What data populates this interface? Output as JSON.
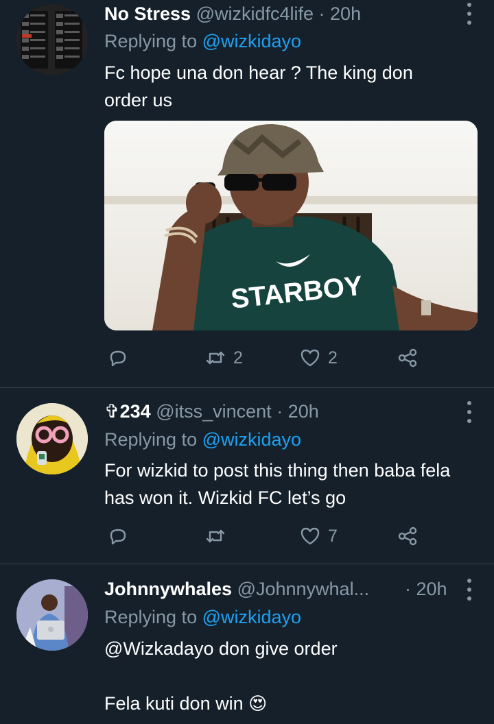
{
  "tweets": [
    {
      "name": "No Stress",
      "handle": "@wizkidfc4life",
      "time": "· 20h",
      "reply_prefix": "Replying to",
      "reply_mention": "@wizkidayo",
      "text": "Fc hope una don hear ? The king don order us",
      "retweets": "2",
      "likes": "2",
      "media_text": "STARBOY"
    },
    {
      "name": "✞234",
      "handle": "@itss_vincent",
      "time": "· 20h",
      "reply_prefix": "Replying to",
      "reply_mention": "@wizkidayo",
      "text": "For wizkid to post this thing then baba fela has won it. Wizkid FC let’s go",
      "retweets": "",
      "likes": "7"
    },
    {
      "name": "Johnnywhales",
      "handle": "@Johnnywhal...",
      "time": "· 20h",
      "reply_prefix": "Replying to",
      "reply_mention": "@wizkidayo",
      "text": "@Wizkadayo don give order\n\nFela kuti don win",
      "emoji": "😍"
    }
  ],
  "icons": {
    "reply": "reply-icon",
    "retweet": "retweet-icon",
    "like": "heart-icon",
    "share": "share-icon",
    "more": "more-options-icon"
  },
  "colors": {
    "background": "#15202b",
    "secondary_text": "#8899a6",
    "link": "#1da1f2",
    "divider": "#38444d"
  }
}
